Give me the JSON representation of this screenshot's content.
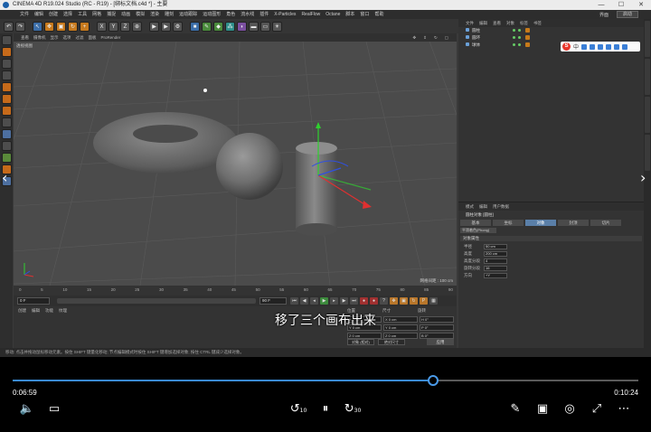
{
  "app": {
    "title": "CINEMA 4D R19.024 Studio (RC - R19) - [绑标文档.c4d *] - 主要",
    "window_controls": [
      "—",
      "☐",
      "✕"
    ]
  },
  "menubar": {
    "items": [
      "文件",
      "编辑",
      "创建",
      "选择",
      "工具",
      "网格",
      "捕捉",
      "动画",
      "模拟",
      "渲染",
      "雕刻",
      "运动跟踪",
      "运动图形",
      "角色",
      "流水线",
      "插件",
      "X-Particles",
      "RealFlow",
      "Octane",
      "脚本",
      "窗口",
      "帮助"
    ],
    "layout_label": "界面",
    "layout_value": "启动"
  },
  "viewport": {
    "menu": [
      "查看",
      "摄像机",
      "显示",
      "选项",
      "过滤",
      "面板",
      "ProRender"
    ],
    "label": "透视视图",
    "scale": "网格间距 : 100 cm"
  },
  "timeline": {
    "ticks": [
      "0",
      "5",
      "10",
      "15",
      "20",
      "25",
      "30",
      "35",
      "40",
      "45",
      "50",
      "55",
      "60",
      "65",
      "70",
      "75",
      "80",
      "85",
      "90"
    ],
    "start_field": "0 F",
    "end_field": "90 F",
    "end_field2": "90 F"
  },
  "material_bar": {
    "tabs": [
      "创建",
      "编辑",
      "功能",
      "纹理"
    ]
  },
  "coords": {
    "headers": [
      "位置",
      "尺寸",
      "旋转"
    ],
    "rows": [
      [
        "X  0 cm",
        "X  0 cm",
        "H  0°"
      ],
      [
        "Y  0 cm",
        "Y  0 cm",
        "P  0°"
      ],
      [
        "Z  0 cm",
        "Z  0 cm",
        "B  0°"
      ]
    ],
    "mode1": "对象 (相对)",
    "mode2": "绝对尺寸",
    "apply": "应用"
  },
  "statusbar": "移动: 点击并拖动鼠标移动元素。按住 SHIFT 键量化移动; 节点编辑模式时按住 SHIFT 键增加选择对象; 按住 CTRL 键减少选择对象。",
  "object_manager": {
    "menu": [
      "文件",
      "编辑",
      "查看",
      "对象",
      "标签",
      "书签"
    ],
    "objects": [
      "圆柱",
      "圆环",
      "球体"
    ]
  },
  "attributes": {
    "menu": [
      "模式",
      "编辑",
      "用户数据"
    ],
    "title": "圆柱对象 [圆柱]",
    "tabs": [
      "基本",
      "坐标",
      "对象",
      "封顶",
      "切片"
    ],
    "sub": "平滑着色(Phong)",
    "section": "对象属性",
    "props": [
      {
        "label": "半径",
        "value": "50 cm"
      },
      {
        "label": "高度",
        "value": "200 cm"
      },
      {
        "label": "高度分段",
        "value": "4"
      },
      {
        "label": "旋转分段",
        "value": "16"
      },
      {
        "label": "方向",
        "value": "+Y"
      }
    ]
  },
  "subtitle": "移了三个画布出来",
  "player": {
    "elapsed": "0:06:59",
    "total": "0:10:24",
    "progress": 0.672,
    "skip_back": "10",
    "skip_forward": "30",
    "accent": "#3b8bd9"
  }
}
